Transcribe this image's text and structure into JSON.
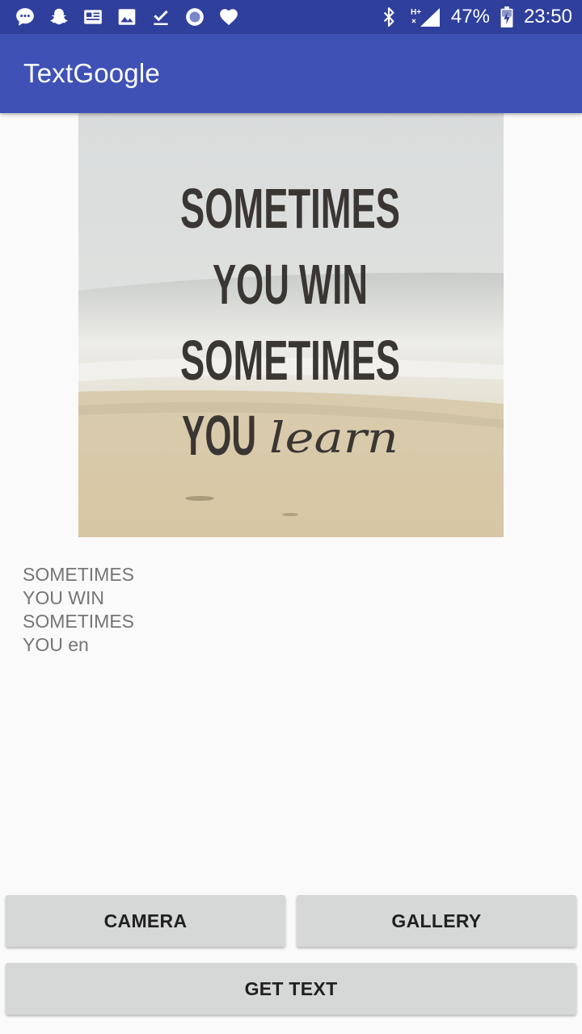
{
  "status_bar": {
    "left_icons": [
      "chat-bubble-icon",
      "snapchat-ghost-icon",
      "news-icon",
      "image-icon",
      "download-done-icon",
      "circle-record-icon",
      "heart-icon"
    ],
    "network_label": "H+",
    "battery_percent": "47%",
    "time": "23:50"
  },
  "app_bar": {
    "title": "TextGoogle",
    "color": "#3f51b5",
    "status_color": "#2f3f9c"
  },
  "photo": {
    "lines": [
      "SOMETIMES",
      "YOU WIN",
      "SOMETIMES",
      "YOU"
    ],
    "script_word": "learn"
  },
  "result": {
    "lines": [
      "SOMETIMES",
      "YOU WIN",
      "SOMETIMES",
      "YOU en"
    ]
  },
  "buttons": {
    "camera": "CAMERA",
    "gallery": "GALLERY",
    "get_text": "GET TEXT"
  }
}
